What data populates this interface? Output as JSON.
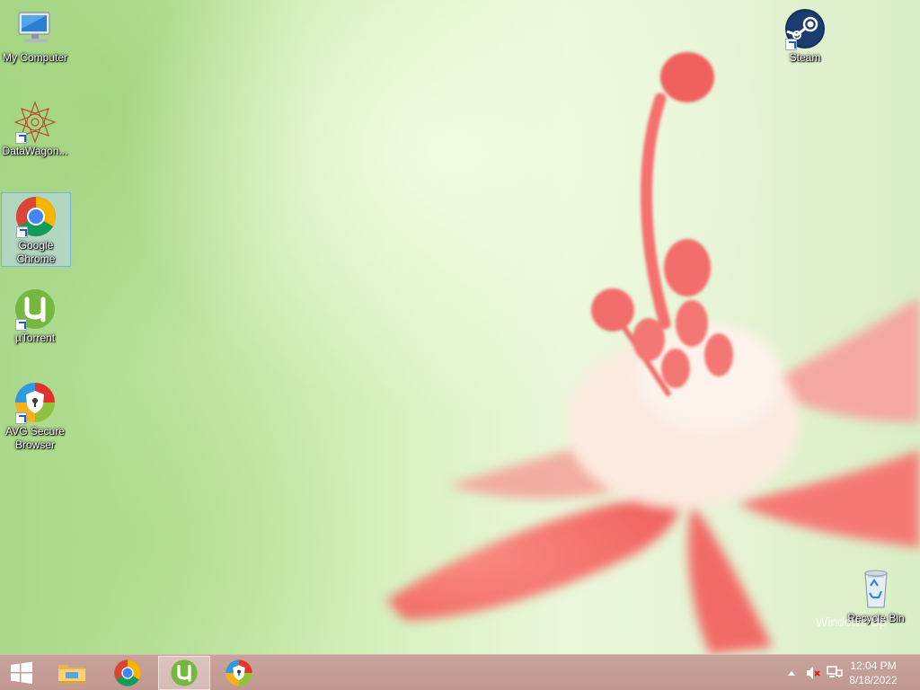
{
  "desktop": {
    "icons": [
      {
        "label": "My Computer",
        "icon": "computer-icon"
      },
      {
        "label": "DataWagon...",
        "icon": "datawagon-icon"
      },
      {
        "label": "Google Chrome",
        "icon": "chrome-icon",
        "selected": true
      },
      {
        "label": "µTorrent",
        "icon": "utorrent-icon"
      },
      {
        "label": "AVG Secure Browser",
        "icon": "avg-browser-icon"
      },
      {
        "label": "Steam",
        "icon": "steam-icon"
      },
      {
        "label": "Recycle Bin",
        "icon": "recycle-bin-icon"
      }
    ],
    "watermark": "Windows Up"
  },
  "taskbar": {
    "start": "windows-start-icon",
    "pinned": [
      {
        "name": "File Explorer",
        "icon": "file-explorer-icon"
      },
      {
        "name": "Google Chrome",
        "icon": "chrome-icon"
      },
      {
        "name": "µTorrent",
        "icon": "utorrent-icon",
        "active": true
      },
      {
        "name": "AVG Secure Browser",
        "icon": "avg-browser-icon"
      }
    ],
    "tray": {
      "icons": [
        "show-hidden-icons-arrow",
        "volume-muted-icon",
        "network-icon"
      ],
      "time": "12:04 PM",
      "date": "8/18/2022"
    }
  },
  "colors": {
    "taskbar": "#c19891",
    "selection": "#b9d7f0",
    "flower": "#f2716d"
  }
}
